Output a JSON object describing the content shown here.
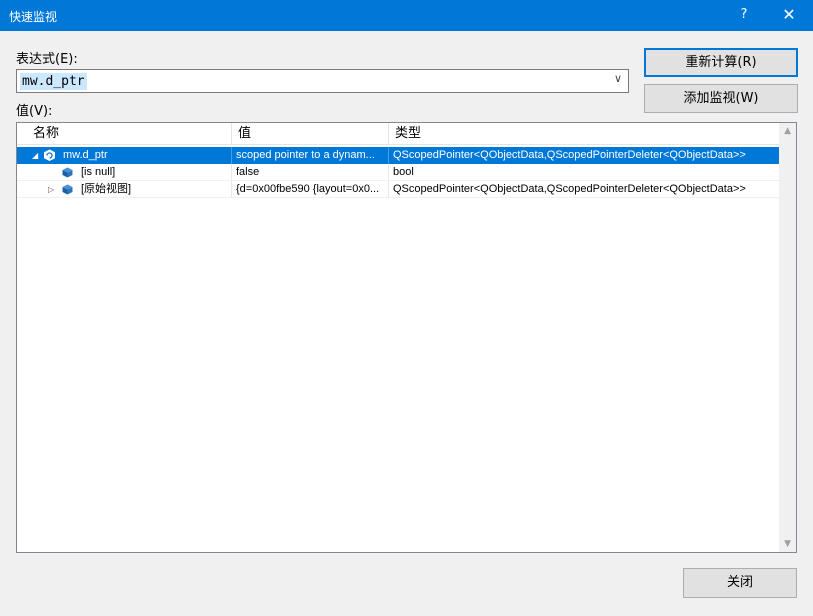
{
  "window": {
    "title": "快速监视",
    "help": "?",
    "close": "✕"
  },
  "expression": {
    "label": "表达式(E):",
    "value": "mw.d_ptr"
  },
  "value_label": "值(V):",
  "buttons": {
    "reevaluate": "重新计算(R)",
    "add_watch": "添加监视(W)",
    "close": "关闭"
  },
  "grid": {
    "columns": [
      "名称",
      "值",
      "类型"
    ],
    "rows": [
      {
        "name": "mw.d_ptr",
        "value": "scoped pointer to a dynam...",
        "type": "QScopedPointer<QObjectData,QScopedPointerDeleter<QObjectData>>",
        "expander": "expanded",
        "selected": true
      },
      {
        "name": "[is null]",
        "value": "false",
        "type": "bool",
        "expander": "none",
        "selected": false
      },
      {
        "name": "[原始视图]",
        "value": "{d=0x00fbe590 {layout=0x0...",
        "type": "QScopedPointer<QObjectData,QScopedPointerDeleter<QObjectData>>",
        "expander": "collapsed",
        "selected": false
      }
    ]
  },
  "colors": {
    "titlebar": "#0078d7",
    "selection": "#0078d7",
    "object_icon": "#1f5fa6"
  }
}
